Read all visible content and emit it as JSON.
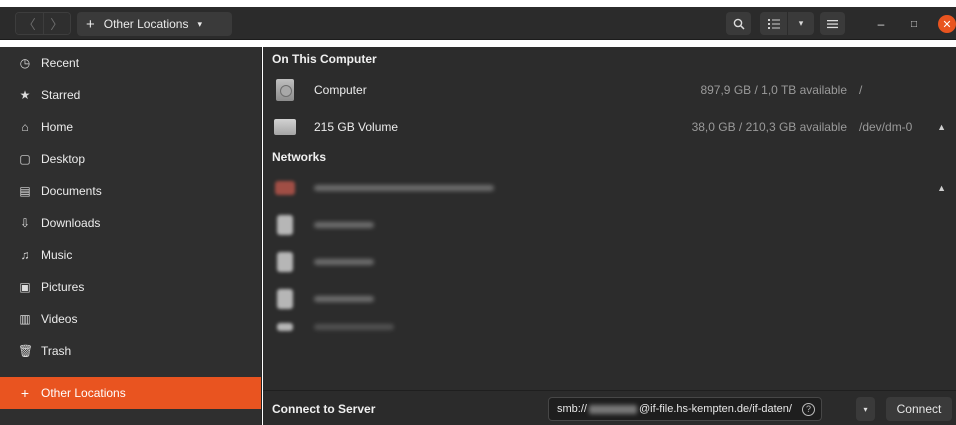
{
  "headerbar": {
    "back_icon": "chevron-left-icon",
    "forward_icon": "chevron-right-icon",
    "path_plus": "+",
    "path_label": "Other Locations",
    "path_caret": "▾",
    "search_icon": "search-icon",
    "view_icon": "list-view-icon",
    "view_caret": "▾",
    "menu_icon": "hamburger-menu-icon",
    "minimize": "–",
    "maximize": "□",
    "close": "✕"
  },
  "sidebar": {
    "items": [
      {
        "icon": "◷",
        "label": "Recent"
      },
      {
        "icon": "★",
        "label": "Starred"
      },
      {
        "icon": "⌂",
        "label": "Home"
      },
      {
        "icon": "▢",
        "label": "Desktop"
      },
      {
        "icon": "▤",
        "label": "Documents"
      },
      {
        "icon": "⇩",
        "label": "Downloads"
      },
      {
        "icon": "♫",
        "label": "Music"
      },
      {
        "icon": "▣",
        "label": "Pictures"
      },
      {
        "icon": "▥",
        "label": "Videos"
      },
      {
        "icon": "🗑",
        "label": "Trash"
      }
    ],
    "other_locations": {
      "icon": "+",
      "label": "Other Locations"
    }
  },
  "content": {
    "on_this_computer_title": "On This Computer",
    "computer": {
      "name": "Computer",
      "available": "897,9 GB / 1,0 TB available",
      "mount": "/"
    },
    "volume": {
      "name": "215 GB Volume",
      "available": "38,0 GB / 210,3 GB available",
      "mount": "/dev/dm-0",
      "eject": "▲"
    },
    "networks_title": "Networks",
    "network_first_eject": "▲"
  },
  "bottombar": {
    "connect_label": "Connect to Server",
    "server_prefix": "smb://",
    "server_suffix": "@if-file.hs-kempten.de/if-daten/",
    "help": "?",
    "dropdown": "▾",
    "connect_button": "Connect"
  },
  "colors": {
    "accent": "#e95420",
    "sidebar_bg": "#2f2f2f",
    "content_bg": "#2c2c2c"
  }
}
